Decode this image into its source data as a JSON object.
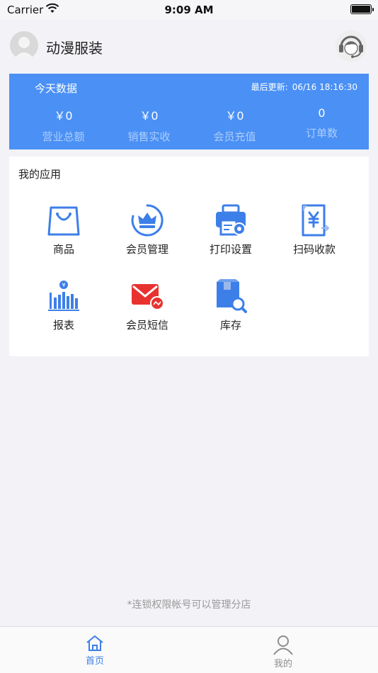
{
  "status_bar": {
    "carrier": "Carrier",
    "time": "9:09 AM"
  },
  "header": {
    "shop_name": "动漫服装",
    "avatar_icon": "user-avatar-icon",
    "service_icon": "customer-service-icon"
  },
  "stats": {
    "title": "今天数据",
    "last_update_label": "最后更新:",
    "last_update_time": "06/16 18:16:30",
    "items": [
      {
        "value": "￥0",
        "label": "营业总额"
      },
      {
        "value": "￥0",
        "label": "销售实收"
      },
      {
        "value": "￥0",
        "label": "会员充值"
      },
      {
        "value": "0",
        "label": "订单数"
      }
    ]
  },
  "apps": {
    "title": "我的应用",
    "items": [
      {
        "label": "商品",
        "icon": "shopping-bag-icon"
      },
      {
        "label": "会员管理",
        "icon": "crown-icon"
      },
      {
        "label": "打印设置",
        "icon": "printer-icon"
      },
      {
        "label": "扫码收款",
        "icon": "yuan-document-icon"
      },
      {
        "label": "报表",
        "icon": "bar-chart-icon"
      },
      {
        "label": "会员短信",
        "icon": "mail-icon"
      },
      {
        "label": "库存",
        "icon": "box-search-icon"
      }
    ]
  },
  "footer_note": "*连锁权限帐号可以管理分店",
  "tabs": [
    {
      "label": "首页",
      "icon": "home-icon",
      "active": true
    },
    {
      "label": "我的",
      "icon": "person-icon",
      "active": false
    }
  ],
  "colors": {
    "accent": "#4a90f5",
    "mail_red": "#e8322f",
    "inactive": "#8e8e8e"
  }
}
